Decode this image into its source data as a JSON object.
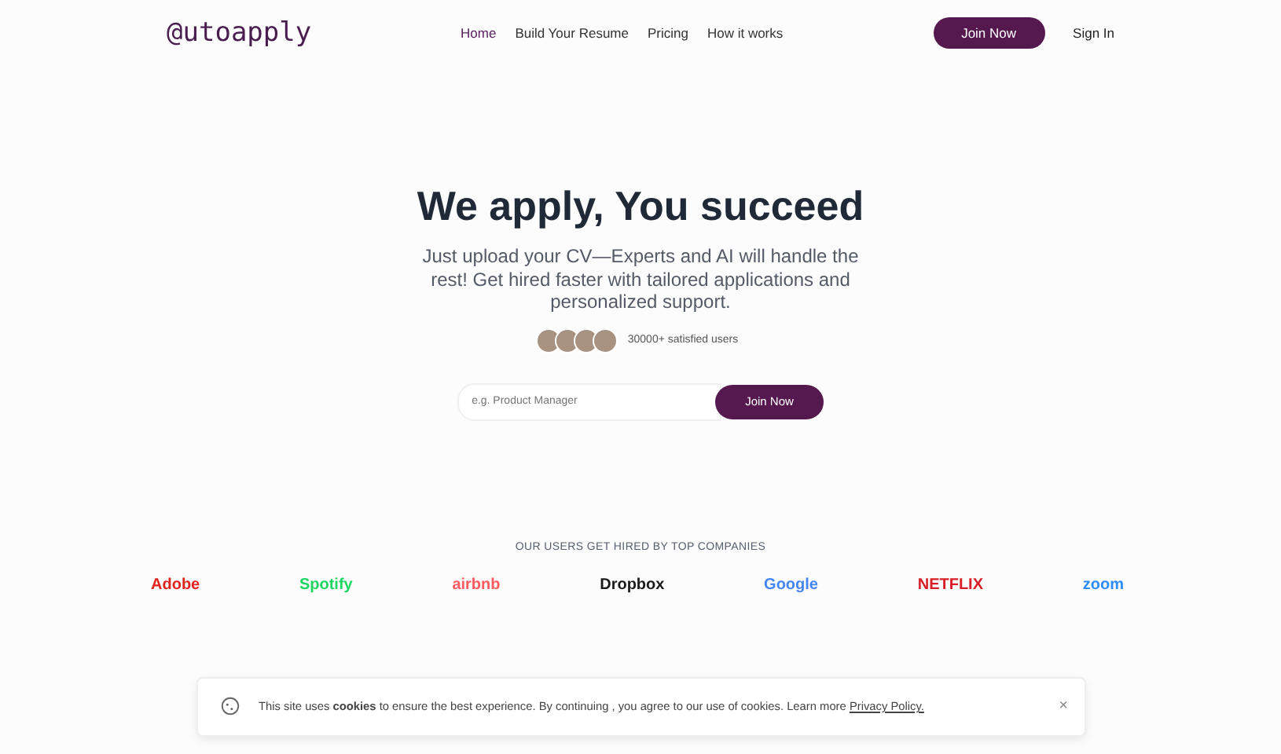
{
  "logo": "@utoapply",
  "nav": [
    {
      "label": "Home",
      "selected": true
    },
    {
      "label": "Build Your Resume",
      "selected": false
    },
    {
      "label": "Pricing",
      "selected": false
    },
    {
      "label": "How it works",
      "selected": false
    }
  ],
  "join_button": "Join Now",
  "sign_in": "Sign In",
  "hero": {
    "title": "We apply, You succeed",
    "subtitle": "Just upload your CV—Experts and AI will handle the rest! Get hired faster with tailored applications and personalized support.",
    "users_count": "30000+ satisfied users",
    "search": {
      "placeholder": "e.g. Product Manager"
    },
    "cta": "Join Now"
  },
  "companies": {
    "heading": "OUR USERS GET HIRED BY TOP COMPANIES",
    "logos": [
      {
        "name": "Adobe",
        "color": "#e0231b"
      },
      {
        "name": "Spotify",
        "color": "#1ed760"
      },
      {
        "name": "airbnb",
        "color": "#ff5a5f"
      },
      {
        "name": "Dropbox",
        "color": "#1a1a1a"
      },
      {
        "name": "Google",
        "color": "#4285f4"
      },
      {
        "name": "NETFLIX",
        "color": "#d81f26"
      },
      {
        "name": "zoom",
        "color": "#2d8cff"
      }
    ]
  },
  "cookie": {
    "text": "This site uses **cookies** to ensure the best experience. By continuing , you agree to our use of cookies. Learn more",
    "link": "Privacy Policy.",
    "close": "×"
  }
}
